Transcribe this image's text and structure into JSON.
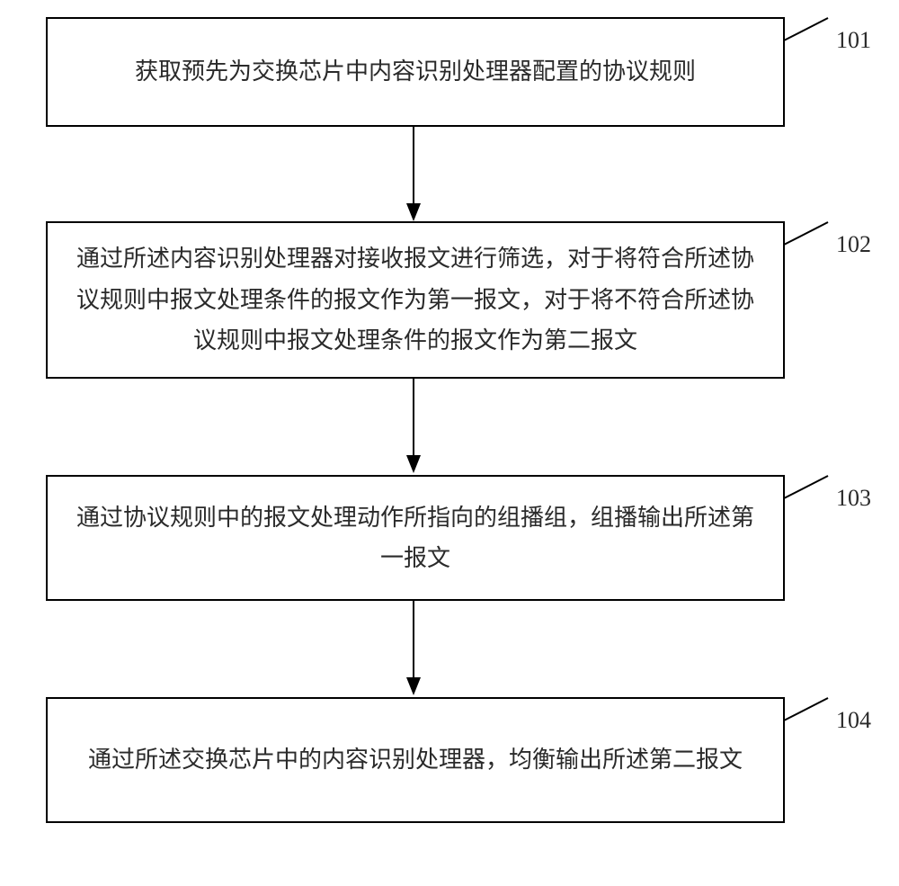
{
  "chart_data": {
    "type": "flowchart",
    "direction": "top-to-bottom",
    "title": "",
    "steps": [
      {
        "id": "101",
        "text": "获取预先为交换芯片中内容识别处理器配置的协议规则"
      },
      {
        "id": "102",
        "text": "通过所述内容识别处理器对接收报文进行筛选，对于将符合所述协议规则中报文处理条件的报文作为第一报文，对于将不符合所述协议规则中报文处理条件的报文作为第二报文"
      },
      {
        "id": "103",
        "text": "通过协议规则中的报文处理动作所指向的组播组，组播输出所述第一报文"
      },
      {
        "id": "104",
        "text": "通过所述交换芯片中的内容识别处理器，均衡输出所述第二报文"
      }
    ],
    "edges": [
      {
        "from": "101",
        "to": "102"
      },
      {
        "from": "102",
        "to": "103"
      },
      {
        "from": "103",
        "to": "104"
      }
    ]
  }
}
